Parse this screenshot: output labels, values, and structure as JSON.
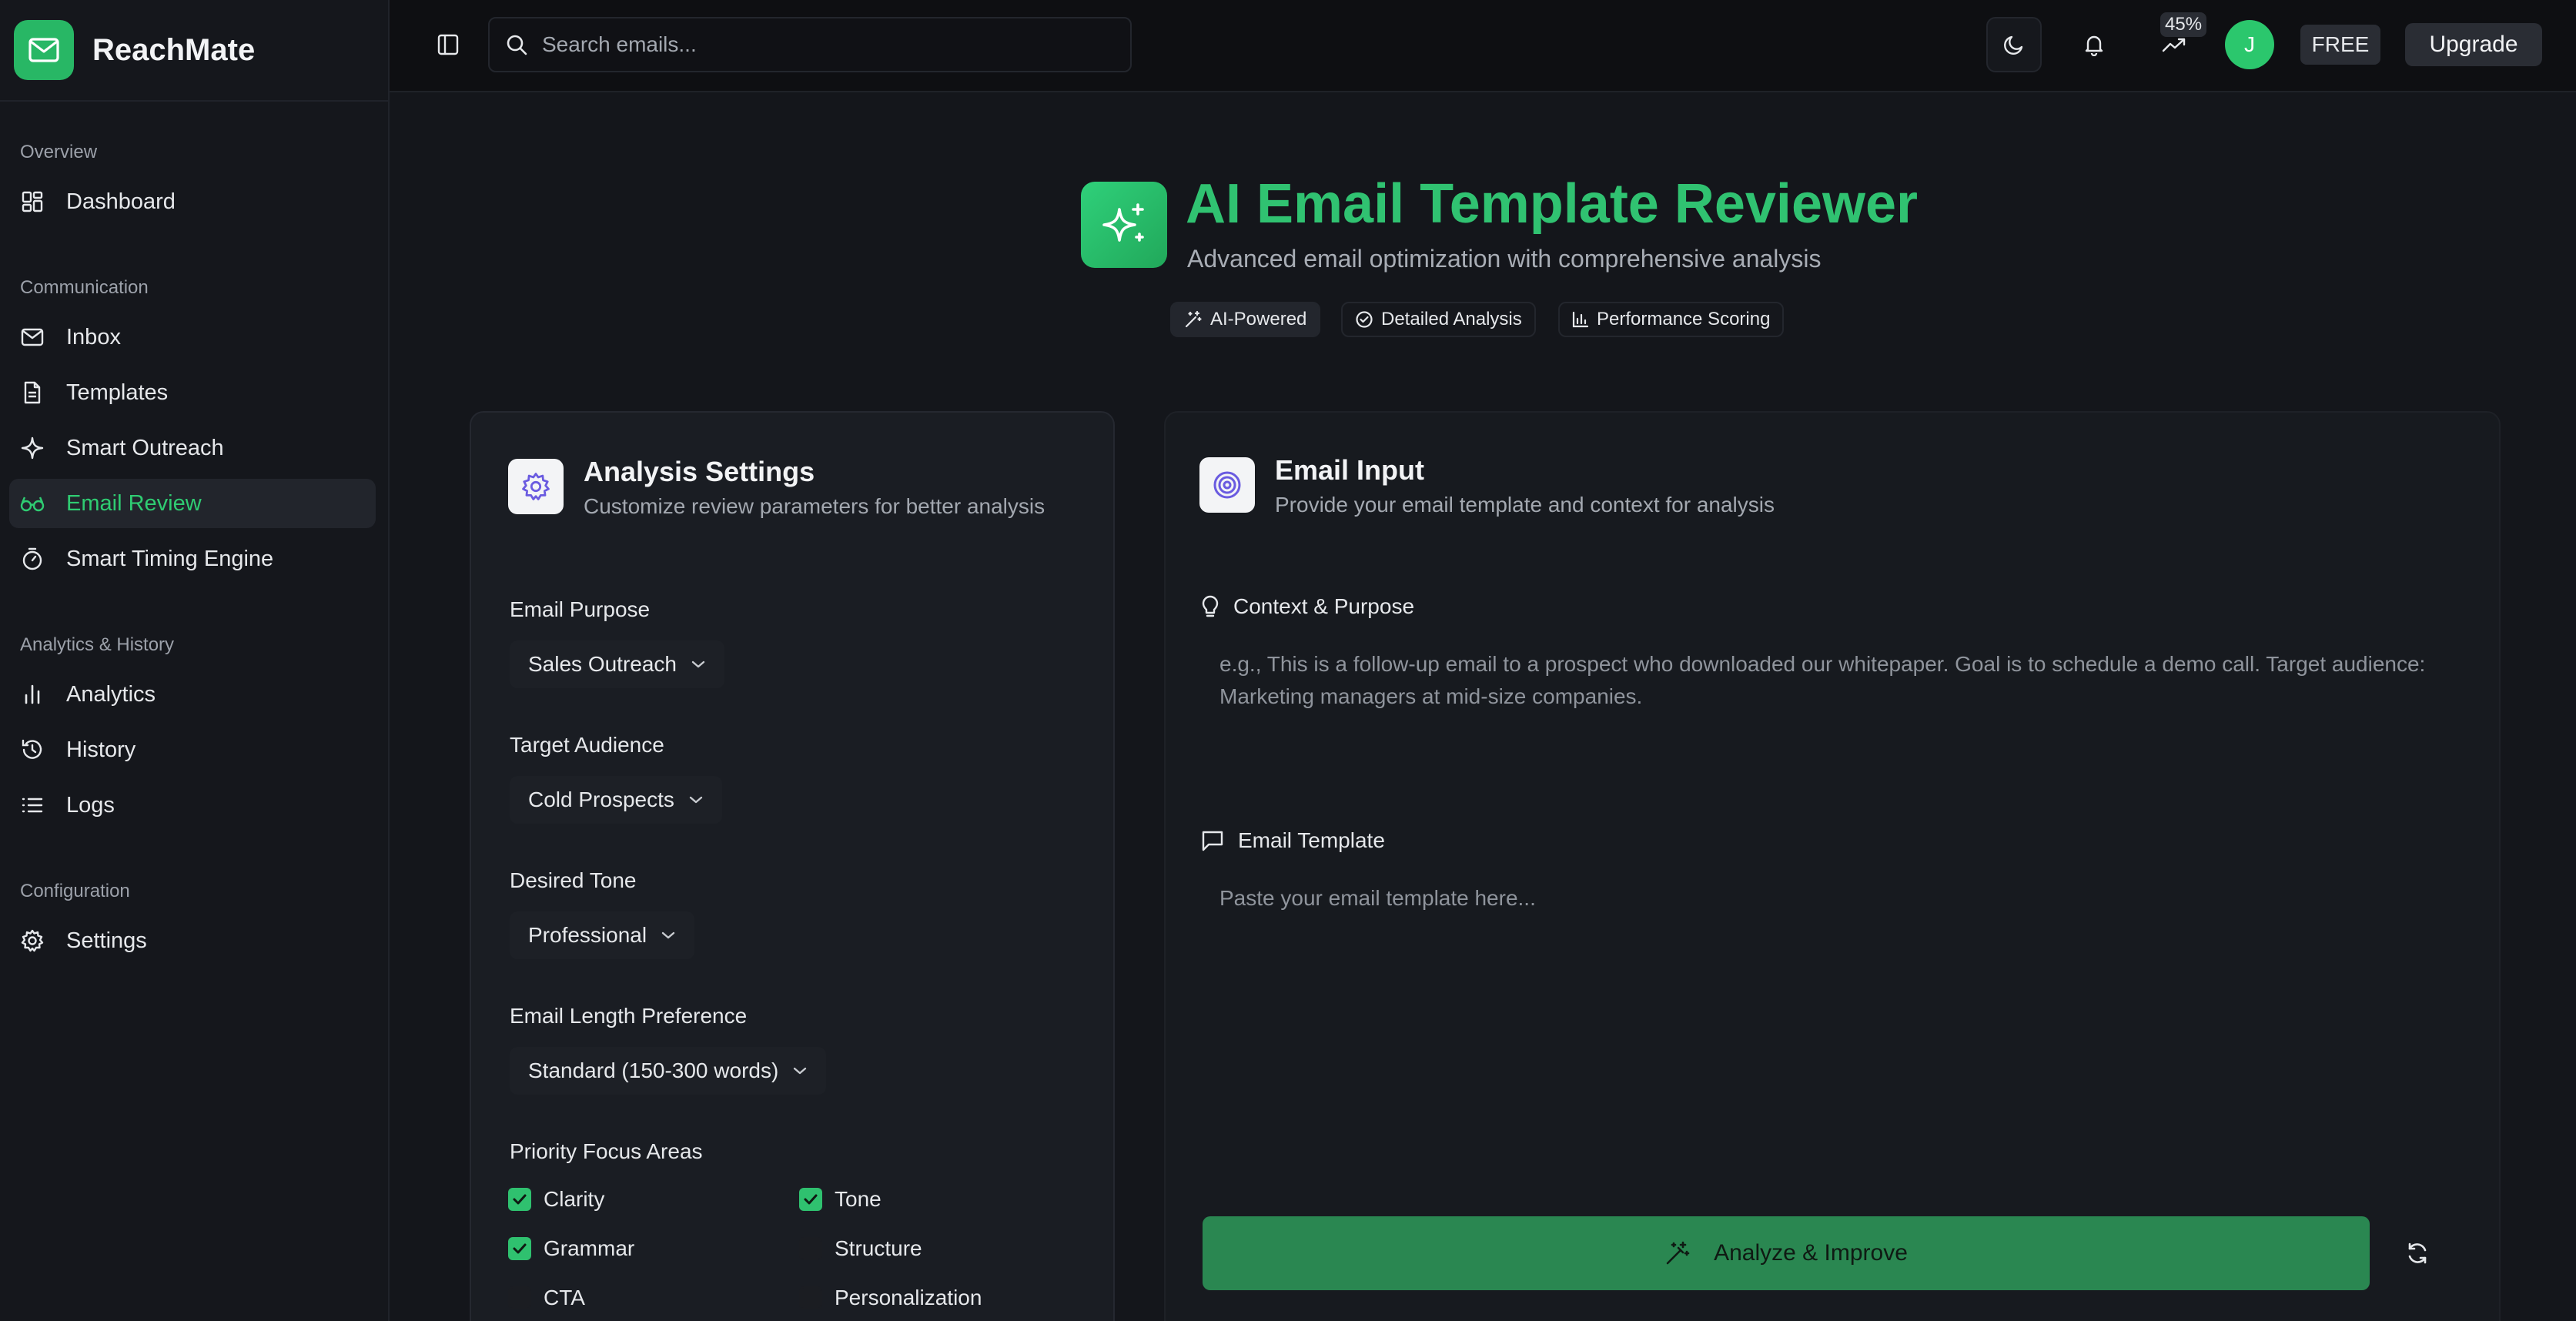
{
  "brand": {
    "name": "ReachMate"
  },
  "sidebar": {
    "sections": [
      {
        "label": "Overview",
        "items": [
          {
            "label": "Dashboard",
            "icon": "dashboard-icon"
          }
        ]
      },
      {
        "label": "Communication",
        "items": [
          {
            "label": "Inbox",
            "icon": "mail-icon"
          },
          {
            "label": "Templates",
            "icon": "file-text-icon"
          },
          {
            "label": "Smart Outreach",
            "icon": "sparkle-icon"
          },
          {
            "label": "Email Review",
            "icon": "glasses-icon",
            "active": true
          },
          {
            "label": "Smart Timing Engine",
            "icon": "timer-icon"
          }
        ]
      },
      {
        "label": "Analytics & History",
        "items": [
          {
            "label": "Analytics",
            "icon": "bar-chart-icon"
          },
          {
            "label": "History",
            "icon": "history-icon"
          },
          {
            "label": "Logs",
            "icon": "list-icon"
          }
        ]
      },
      {
        "label": "Configuration",
        "items": [
          {
            "label": "Settings",
            "icon": "gear-icon"
          }
        ]
      }
    ]
  },
  "topbar": {
    "search_placeholder": "Search emails...",
    "progress_badge": "45%",
    "avatar_initial": "J",
    "plan_label": "FREE",
    "upgrade_label": "Upgrade"
  },
  "hero": {
    "title": "AI Email Template Reviewer",
    "subtitle": "Advanced email optimization with comprehensive analysis",
    "chips": [
      {
        "label": "AI-Powered",
        "icon": "wand-icon"
      },
      {
        "label": "Detailed Analysis",
        "icon": "check-circle-icon"
      },
      {
        "label": "Performance Scoring",
        "icon": "bar-chart-icon"
      }
    ]
  },
  "settings_card": {
    "title": "Analysis Settings",
    "subtitle": "Customize review parameters for better analysis",
    "email_purpose": {
      "label": "Email Purpose",
      "value": "Sales Outreach"
    },
    "target_audience": {
      "label": "Target Audience",
      "value": "Cold Prospects"
    },
    "desired_tone": {
      "label": "Desired Tone",
      "value": "Professional"
    },
    "length_preference": {
      "label": "Email Length Preference",
      "value": "Standard (150-300 words)"
    },
    "focus_areas": {
      "label": "Priority Focus Areas",
      "items": [
        {
          "label": "Clarity",
          "checked": true
        },
        {
          "label": "Tone",
          "checked": true
        },
        {
          "label": "Grammar",
          "checked": true
        },
        {
          "label": "Structure",
          "checked": false
        },
        {
          "label": "CTA",
          "checked": false
        },
        {
          "label": "Personalization",
          "checked": false
        }
      ]
    }
  },
  "input_card": {
    "title": "Email Input",
    "subtitle": "Provide your email template and context for analysis",
    "context": {
      "label": "Context & Purpose",
      "placeholder": "e.g., This is a follow-up email to a prospect who downloaded our whitepaper. Goal is to schedule a demo call. Target audience: Marketing managers at mid-size companies."
    },
    "template": {
      "label": "Email Template",
      "placeholder": "Paste your email template here..."
    },
    "analyze_label": "Analyze & Improve"
  },
  "colors": {
    "accent": "#30c271",
    "background": "#14161b",
    "card": "#1a1d23",
    "analyze_button": "#2a8751"
  }
}
